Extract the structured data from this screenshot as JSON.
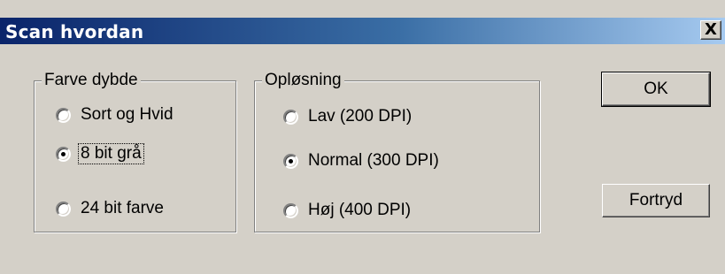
{
  "window": {
    "title": "Scan hvordan",
    "close_symbol": "X"
  },
  "color_depth": {
    "label": "Farve dybde",
    "options": [
      {
        "label": "Sort og Hvid",
        "selected": false
      },
      {
        "label": "8 bit grå",
        "selected": true
      },
      {
        "label": "24 bit farve",
        "selected": false
      }
    ]
  },
  "resolution": {
    "label": "Opløsning",
    "options": [
      {
        "label": "Lav (200 DPI)",
        "selected": false
      },
      {
        "label": "Normal (300 DPI)",
        "selected": true
      },
      {
        "label": "Høj (400 DPI)",
        "selected": false
      }
    ]
  },
  "buttons": {
    "ok": "OK",
    "cancel": "Fortryd"
  }
}
